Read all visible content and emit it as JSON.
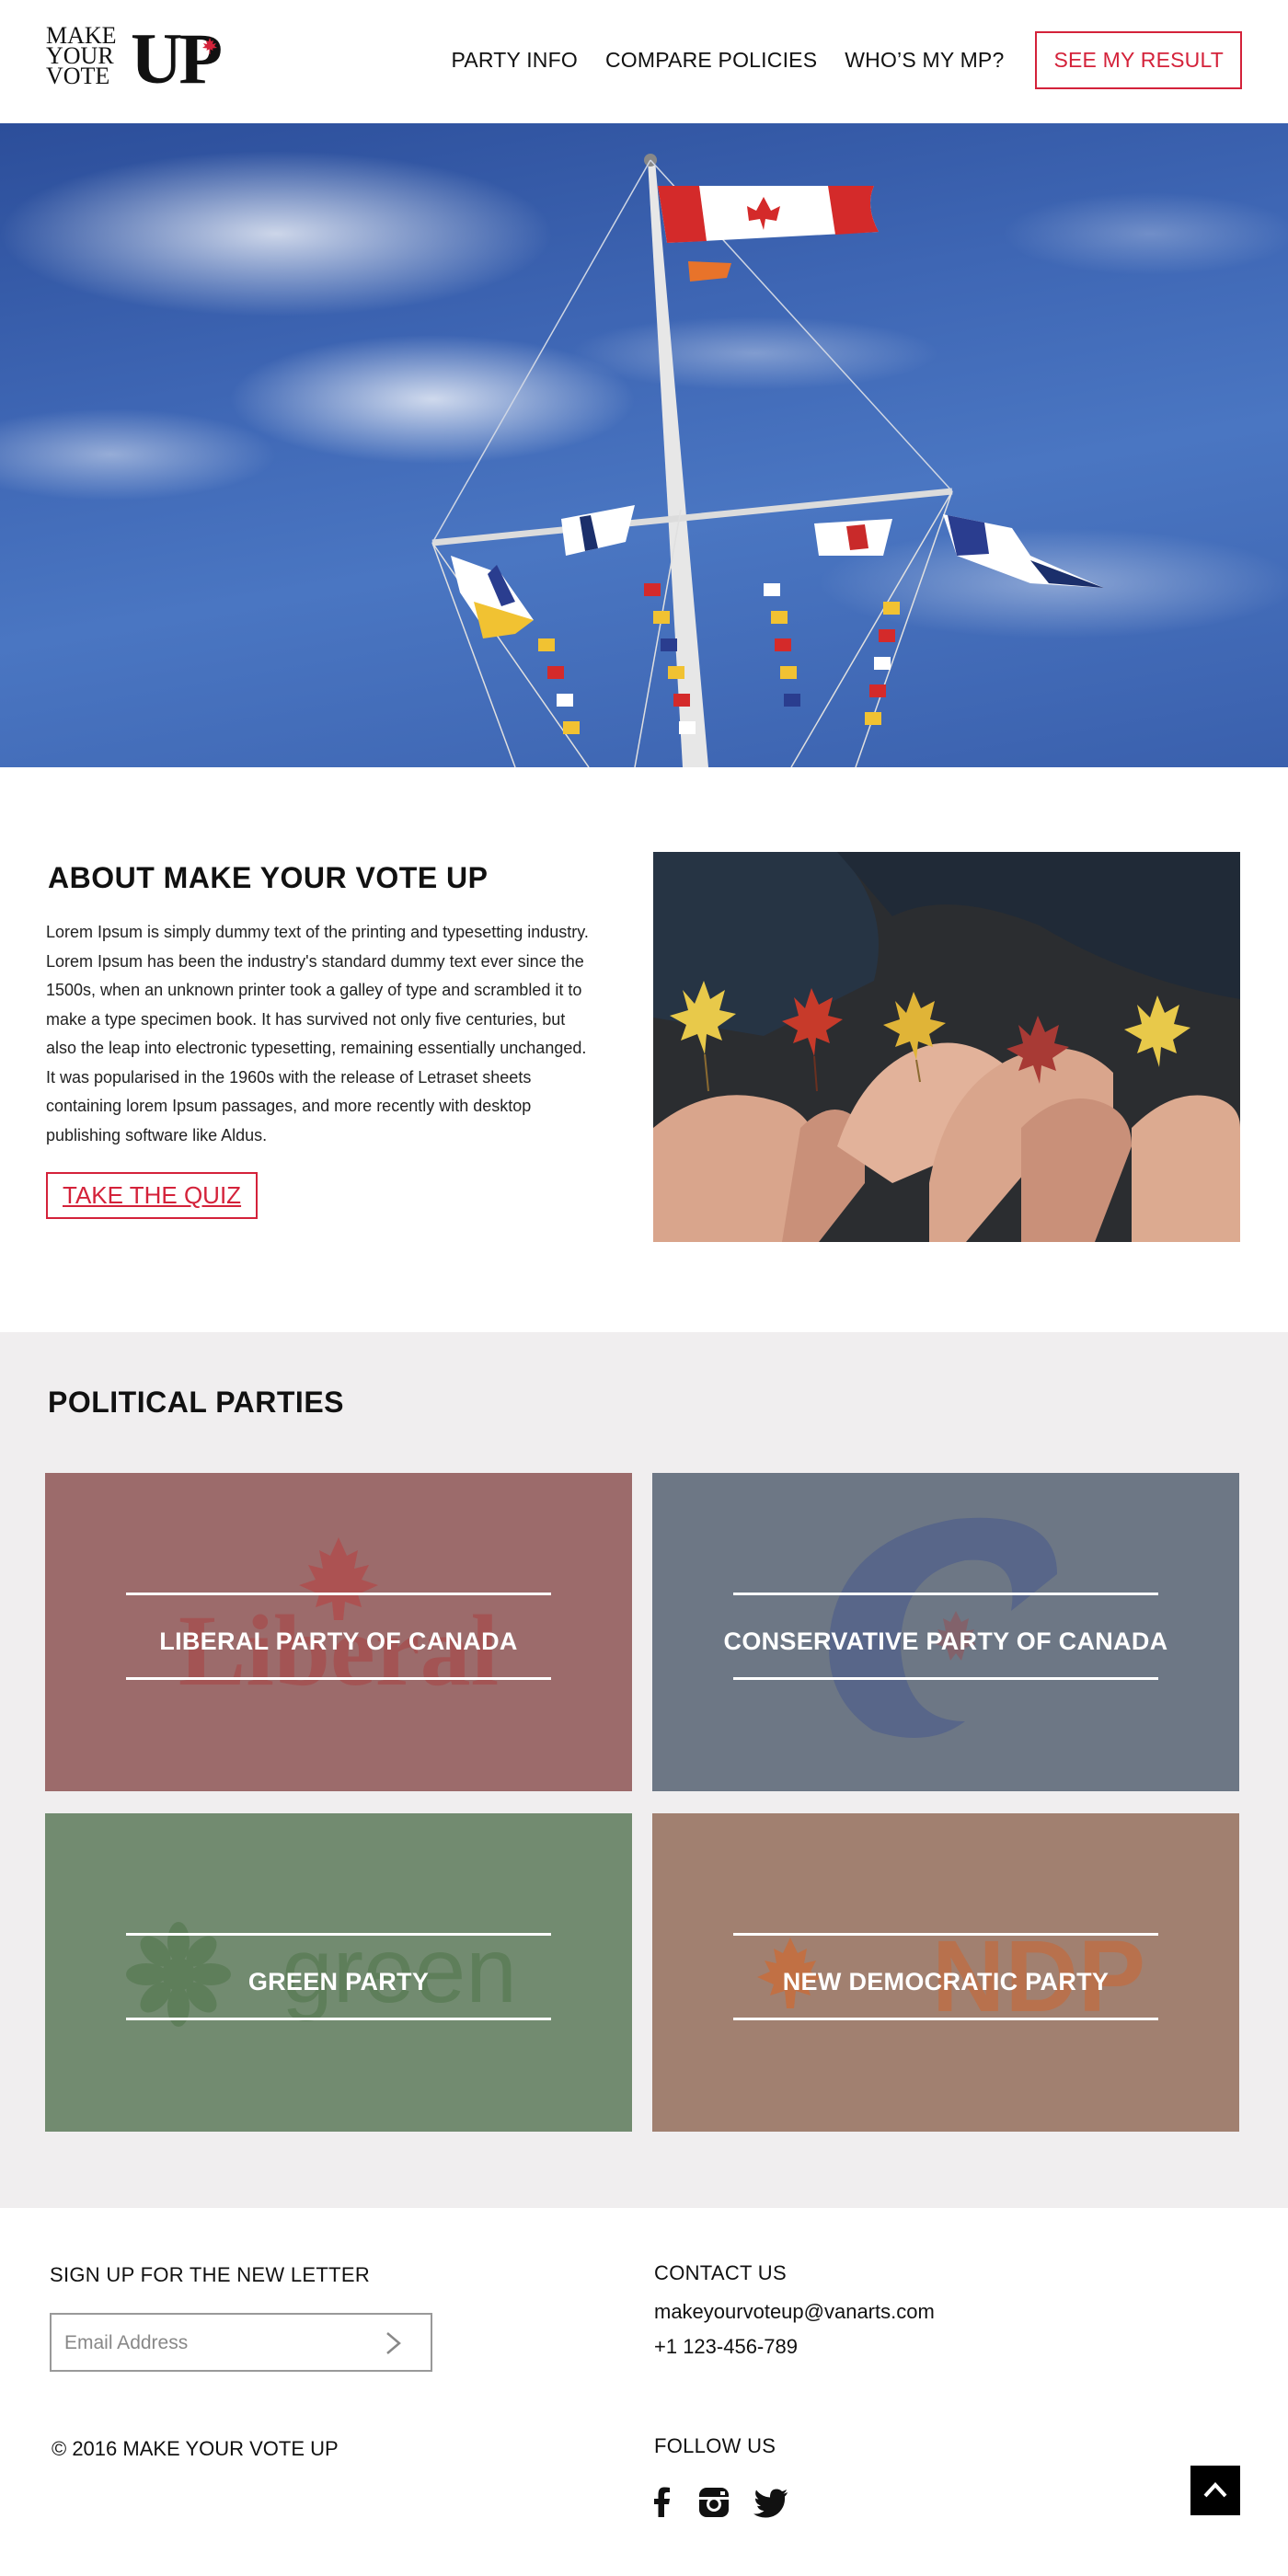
{
  "header": {
    "logo": {
      "line1": "MAKE",
      "line2": "YOUR",
      "line3": "VOTE",
      "big": "UP"
    },
    "nav": [
      {
        "label": "PARTY INFO"
      },
      {
        "label": "COMPARE POLICIES"
      },
      {
        "label": "WHO’S MY MP?"
      }
    ],
    "cta_label": "SEE MY RESULT"
  },
  "about": {
    "title": "ABOUT MAKE YOUR VOTE UP",
    "body": "Lorem Ipsum is simply dummy text of the printing and typesetting industry. Lorem Ipsum has been the industry's standard dummy text ever since the 1500s, when an unknown printer took a galley of type and scrambled it to make a type specimen book. It has survived not only five centuries, but also the leap into electronic typesetting, remaining essentially unchanged. It was popularised in the 1960s with the release of Letraset sheets containing  lorem Ipsum passages, and more recently with desktop publishing software like Aldus.",
    "quiz_label": "TAKE THE QUIZ"
  },
  "parties": {
    "title": "POLITICAL PARTIES",
    "cards": [
      {
        "name": "LIBERAL PARTY OF CANADA",
        "watermark": "Liberal",
        "color": "#9c6b6b"
      },
      {
        "name": "CONSERVATIVE PARTY OF CANADA",
        "watermark": "",
        "color": "#6d7785"
      },
      {
        "name": "GREEN PARTY",
        "watermark": "green",
        "color": "#728b70"
      },
      {
        "name": "NEW DEMOCRATIC PARTY",
        "watermark": "NDP",
        "color": "#a18070"
      }
    ]
  },
  "footer": {
    "newsletter_title": "SIGN UP FOR THE NEW LETTER",
    "email_placeholder": "Email Address",
    "contact_title": "CONTACT US",
    "email": "makeyourvoteup@vanarts.com",
    "phone": "+1 123-456-789",
    "copyright": "© 2016 MAKE YOUR VOTE UP",
    "follow_title": "FOLLOW US"
  },
  "colors": {
    "accent": "#d4223a"
  }
}
